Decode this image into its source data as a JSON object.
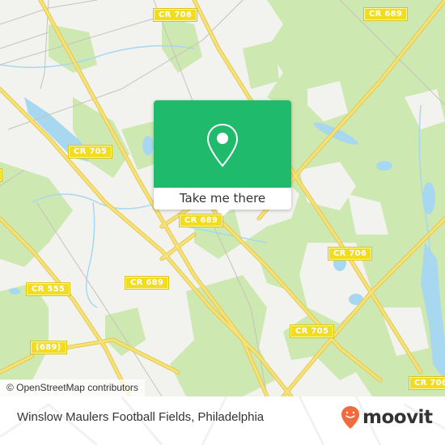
{
  "map": {
    "attribution": "© OpenStreetMap contributors",
    "colors": {
      "land": "#f2f2ee",
      "forest": "#cde8b0",
      "water": "#a8d8f0",
      "road_major": "#f3dd5c",
      "road_minor": "#c8c2bc",
      "label_bg": "#f1dc1f"
    },
    "road_labels": [
      {
        "id": "cr706-top",
        "text": "CR 706"
      },
      {
        "id": "cr689-topright",
        "text": "CR 689"
      },
      {
        "id": "cr705-left",
        "text": "CR 705"
      },
      {
        "id": "cr689-center",
        "text": "CR 689"
      },
      {
        "id": "cr706-right",
        "text": "CR 706"
      },
      {
        "id": "cr555",
        "text": "CR 555"
      },
      {
        "id": "cr689-left",
        "text": "CR 689"
      },
      {
        "id": "cr705-right",
        "text": "CR 705"
      },
      {
        "id": "689-bottom",
        "text": "(689)"
      },
      {
        "id": "cr706-bottomright",
        "text": "CR 706"
      }
    ]
  },
  "popup": {
    "icon": "map-pin-icon",
    "button_label": "Take me there",
    "accent": "#1fba6c"
  },
  "footer": {
    "place_title": "Winslow Maulers Football Fields, Philadelphia",
    "brand": "moovit",
    "brand_icon": "moovit-logo-icon",
    "brand_color": "#f26a3d"
  }
}
